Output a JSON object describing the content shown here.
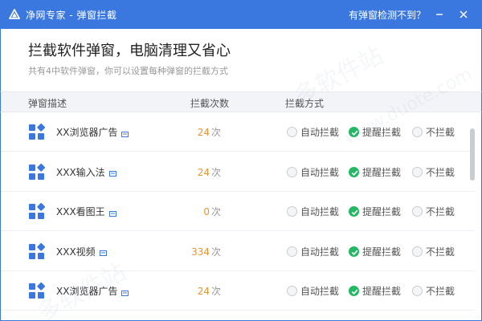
{
  "window": {
    "title": "净网专家 - 弹窗拦截",
    "help_link": "有弹窗检测不到？",
    "minimize_icon": "minimize-icon",
    "close_icon": "close-icon",
    "accent_color": "#3a78e0"
  },
  "header": {
    "title": "拦截软件弹窗，电脑清理又省心",
    "subtitle": "共有4中软件弹窗，你可以设置每种弹窗的拦截方式"
  },
  "table": {
    "columns": [
      "弹窗描述",
      "拦截次数",
      "拦截方式"
    ],
    "options": [
      "自动拦截",
      "提醒拦截",
      "不拦截"
    ],
    "count_unit": "次",
    "rows": [
      {
        "name": "XX浏览器广告",
        "count": "24",
        "selected": "提醒拦截"
      },
      {
        "name": "XXX输入法",
        "count": "24",
        "selected": "提醒拦截"
      },
      {
        "name": "XXX看图王",
        "count": "0",
        "selected": "提醒拦截"
      },
      {
        "name": "XXX视频",
        "count": "334",
        "selected": "提醒拦截"
      },
      {
        "name": "XX浏览器广告",
        "count": "24",
        "selected": "提醒拦截"
      }
    ],
    "count_color": "#f0932b",
    "selected_color": "#25b864"
  },
  "watermark": [
    "多软件站",
    "www.duote.com"
  ]
}
